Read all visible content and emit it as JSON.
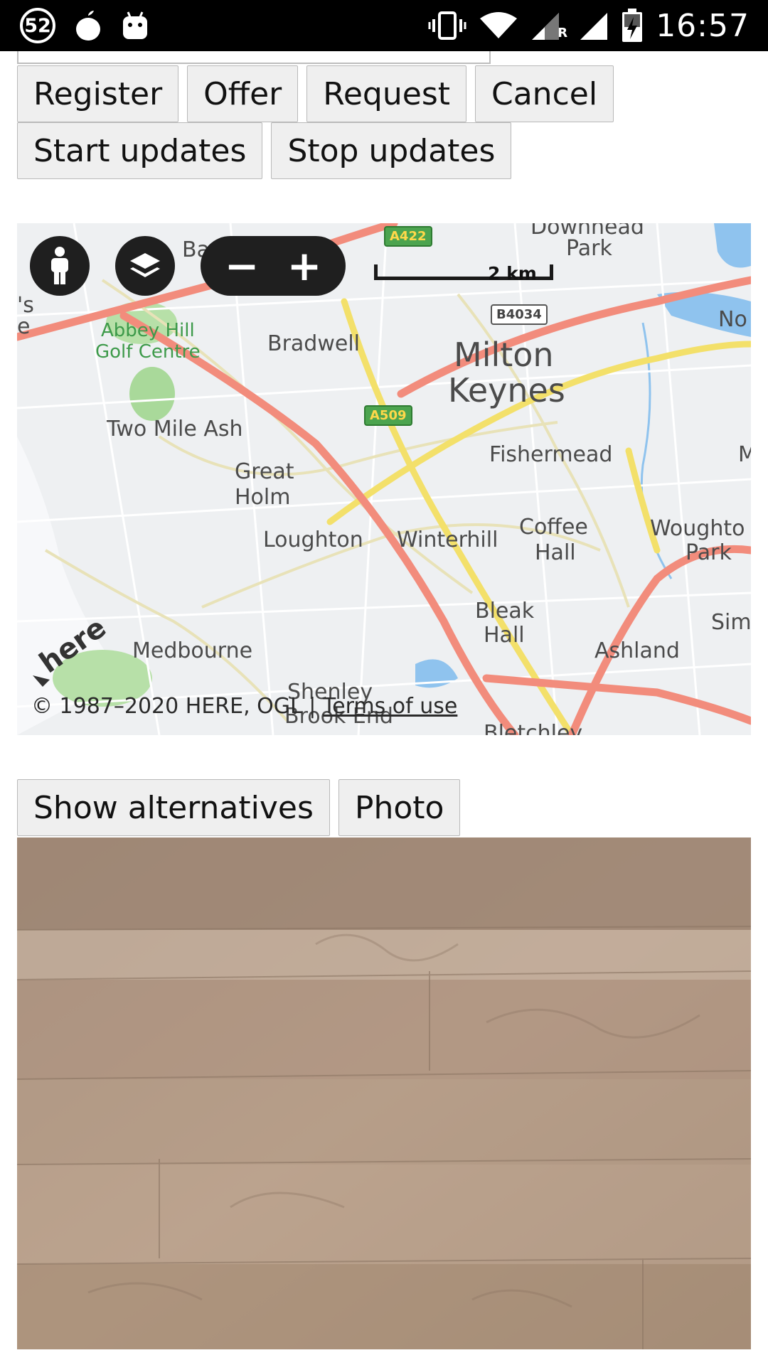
{
  "status_bar": {
    "notification_count": "52",
    "time": "16:57",
    "icons": [
      "notification-badge",
      "fruit-app-icon",
      "android-icon",
      "vibrate-icon",
      "wifi-icon",
      "signal-roaming-icon",
      "signal-icon",
      "battery-charging-icon"
    ],
    "roaming_label": "R"
  },
  "buttons_row1": {
    "register": "Register",
    "offer": "Offer",
    "request": "Request",
    "cancel": "Cancel"
  },
  "buttons_row2": {
    "start_updates": "Start updates",
    "stop_updates": "Stop updates"
  },
  "map": {
    "controls": {
      "person_icon": "person-icon",
      "layers_icon": "layers-icon",
      "zoom_out": "−",
      "zoom_in": "+"
    },
    "scale_label": "2 km",
    "places": {
      "downhead_park_1": "Downhead",
      "downhead_park_2": "Park",
      "ba": "Ba",
      "abbey_hill_1": "Abbey Hill",
      "abbey_hill_2": "Golf Centre",
      "bradwell": "Bradwell",
      "milton": "Milton",
      "keynes": "Keynes",
      "no": "No",
      "two_mile_ash": "Two Mile Ash",
      "fishermead": "Fishermead",
      "m_edge": "M",
      "great": "Great",
      "holm": "Holm",
      "loughton": "Loughton",
      "winterhill": "Winterhill",
      "coffee": "Coffee",
      "hall1": "Hall",
      "woughton": "Woughto",
      "park2": "Park",
      "bleak": "Bleak",
      "hall2": "Hall",
      "sim": "Sim",
      "medbourne": "Medbourne",
      "ashland": "Ashland",
      "shenley": "Shenley",
      "brook_end": "Brook End",
      "bletchley": "Bletchley",
      "left_s": "'s",
      "left_e": "e"
    },
    "roads": {
      "a422": "A422",
      "b4034": "B4034",
      "a509": "A509"
    },
    "logo_text": "here",
    "copyright": "© 1987–2020 HERE, OGL | ",
    "terms": "Terms of use"
  },
  "bottom_buttons": {
    "show_alternatives": "Show alternatives",
    "photo": "Photo"
  }
}
